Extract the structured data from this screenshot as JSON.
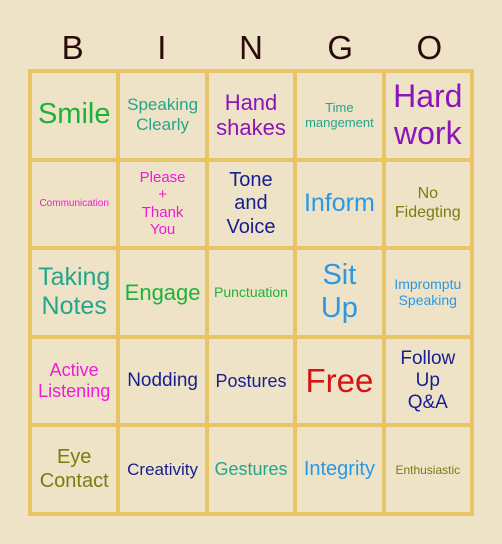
{
  "header": {
    "letters": [
      "B",
      "I",
      "N",
      "G",
      "O"
    ]
  },
  "board": {
    "rows": [
      [
        {
          "text": "Smile",
          "color": "#1DB33A",
          "size": 29
        },
        {
          "text": "Speaking Clearly",
          "color": "#25A58C",
          "size": 17
        },
        {
          "text": "Hand shakes",
          "color": "#8C14B8",
          "size": 22
        },
        {
          "text": "Time mangement",
          "color": "#25A58C",
          "size": 13
        },
        {
          "text": "Hard work",
          "color": "#8C14B8",
          "size": 32
        }
      ],
      [
        {
          "text": "Communication",
          "color": "#EE1AD8",
          "size": 10
        },
        {
          "text": "Please + Thank You",
          "color": "#EE1AD8",
          "size": 15
        },
        {
          "text": "Tone and Voice",
          "color": "#161E90",
          "size": 20
        },
        {
          "text": "Inform",
          "color": "#2A98E6",
          "size": 25
        },
        {
          "text": "No Fidegting",
          "color": "#7E7A0E",
          "size": 16
        }
      ],
      [
        {
          "text": "Taking Notes",
          "color": "#25A58C",
          "size": 25
        },
        {
          "text": "Engage",
          "color": "#1DB33A",
          "size": 22
        },
        {
          "text": "Punctuation",
          "color": "#1DB33A",
          "size": 14
        },
        {
          "text": "Sit Up",
          "color": "#2A98E6",
          "size": 29
        },
        {
          "text": "Impromptu Speaking",
          "color": "#2A98E6",
          "size": 14
        }
      ],
      [
        {
          "text": "Active Listening",
          "color": "#EE1AD8",
          "size": 18
        },
        {
          "text": "Nodding",
          "color": "#161E90",
          "size": 19
        },
        {
          "text": "Postures",
          "color": "#161E90",
          "size": 18
        },
        {
          "text": "Free",
          "color": "#D41414",
          "size": 33
        },
        {
          "text": "Follow Up Q&A",
          "color": "#161E90",
          "size": 19
        }
      ],
      [
        {
          "text": "Eye Contact",
          "color": "#7E7A0E",
          "size": 20
        },
        {
          "text": "Creativity",
          "color": "#161E90",
          "size": 17
        },
        {
          "text": "Gestures",
          "color": "#25A58C",
          "size": 18
        },
        {
          "text": "Integrity",
          "color": "#2A98E6",
          "size": 20
        },
        {
          "text": "Enthusiastic",
          "color": "#7E7A0E",
          "size": 12
        }
      ]
    ]
  },
  "colors": {
    "background": "#EEE3C6",
    "grid_lines": "#E8C466",
    "header_text": "#2A0A0A"
  }
}
